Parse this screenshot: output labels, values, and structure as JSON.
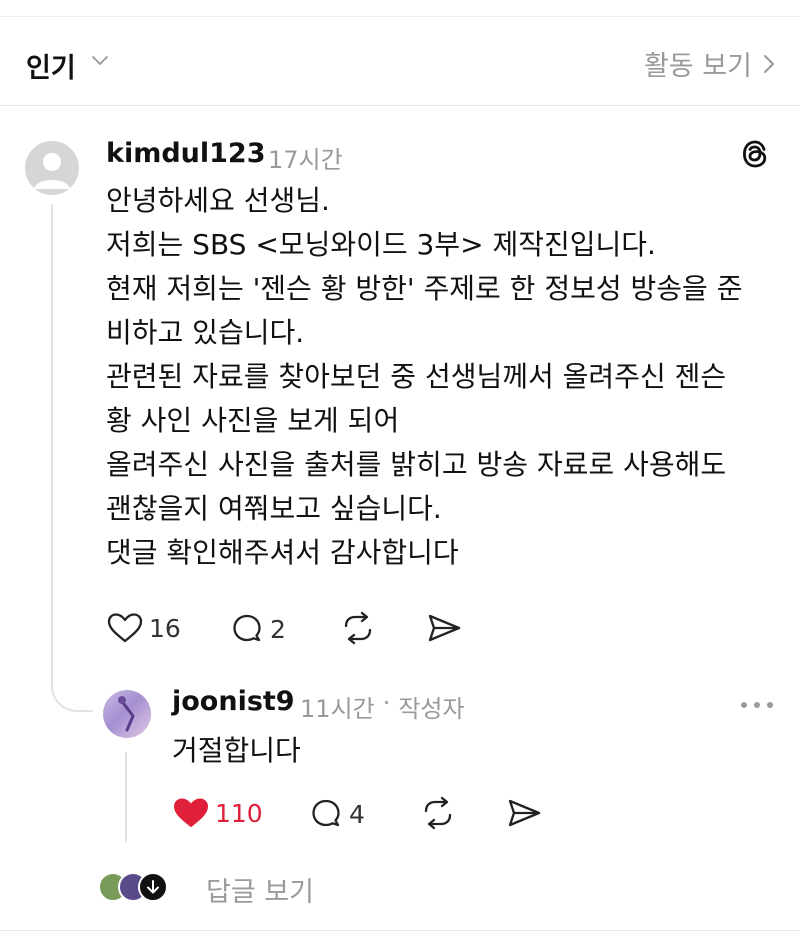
{
  "header": {
    "sort_label": "인기",
    "activity_label": "활동 보기"
  },
  "post": {
    "username": "kimdul123",
    "time": "17시간",
    "lines": [
      "안녕하세요 선생님.",
      "저희는 SBS <모닝와이드 3부> 제작진입니다.",
      "현재 저희는 '젠슨 황 방한' 주제로 한 정보성 방송을 준",
      "비하고 있습니다.",
      "관련된 자료를 찾아보던 중 선생님께서 올려주신 젠슨",
      "황 사인 사진을 보게 되어",
      "올려주신 사진을 출처를 밝히고 방송 자료로 사용해도",
      "괜찮을지 여쭤보고 싶습니다.",
      "댓글 확인해주셔서 감사합니다"
    ],
    "likes": "16",
    "comments": "2"
  },
  "reply": {
    "username": "joonist9",
    "time": "11시간",
    "separator": "·",
    "author_badge": "작성자",
    "text": "거절합니다",
    "likes": "110",
    "comments": "4"
  },
  "more_replies_label": "답글 보기",
  "colors": {
    "like_active": "#e0203a",
    "muted": "#9a9a9a",
    "text": "#111111"
  }
}
